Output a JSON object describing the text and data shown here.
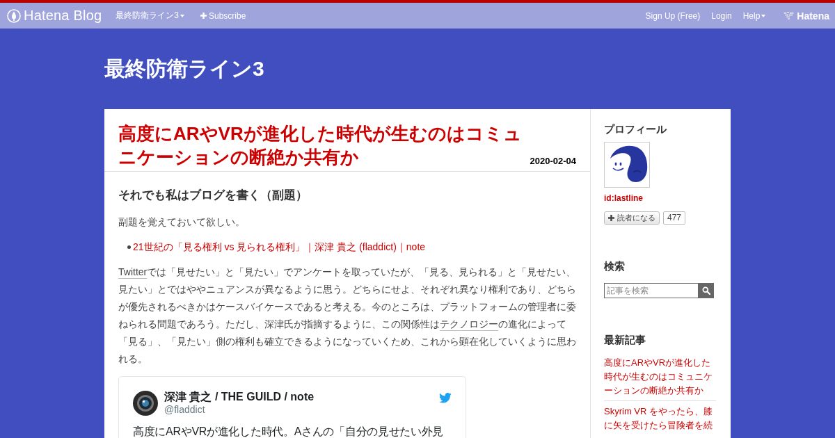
{
  "top_bar": {
    "logo_text": "Hatena Blog",
    "left_links": [
      {
        "label": "最終防衛ライン3",
        "kind": "dropdown"
      },
      {
        "label": "Subscribe",
        "kind": "plus"
      }
    ],
    "right_links": [
      {
        "label": "Sign Up (Free)",
        "kind": "plain"
      },
      {
        "label": "Login",
        "kind": "plain"
      },
      {
        "label": "Help",
        "kind": "dropdown"
      }
    ],
    "brand_text": "Hatena"
  },
  "blog_title": "最終防衛ライン3",
  "article": {
    "title": "高度にARやVRが進化した時代が生むのはコミュニケーションの断絶か共有か",
    "date": "2020-02-04",
    "subtitle": "それでも私はブログを書く（副題）",
    "intro": "副題を覚えておいて欲しい。",
    "links": [
      "21世紀の「見る権利 vs 見られる権利」｜深津 貴之 (fladdict)｜note"
    ],
    "paragraph": [
      {
        "kind": "keyword",
        "text": "Twitter"
      },
      {
        "kind": "text",
        "text": "では「見せたい」と「見たい」でアンケートを取っていたが、「見る、見られる」と「見せたい、見たい」とではややニュアンスが異なるように思う。どちらにせよ、それぞれ異なり権利であり、どちらが優先されるべきかはケースバイケースであると考える。今のところは、プラットフォームの管理者に委ねられる問題であろう。ただし、深津氏が指摘するように、この関係性は"
      },
      {
        "kind": "keyword",
        "text": "テクノロジー"
      },
      {
        "kind": "text",
        "text": "の進化によって「見る」、「見たい」側の権利も確立できるようになっていくため、これから顕在化していくように思われる。"
      }
    ],
    "tweet": {
      "name": "深津 貴之 / THE GUILD / note",
      "handle": "@fladdict",
      "text": "高度にARやVRが進化した時代。Aさんの「自分の見せたい外見"
    }
  },
  "sidebar": {
    "sections": [
      {
        "kind": "profile",
        "heading": "プロフィール",
        "user_id": "id:lastline",
        "subscribe_label": "読者になる",
        "subscriber_count": "477"
      },
      {
        "kind": "search",
        "heading": "検索",
        "placeholder": "記事を検索"
      },
      {
        "kind": "recent",
        "heading": "最新記事",
        "entries": [
          "高度にARやVRが進化した時代が生むのはコミュニケーションの断絶か共有か",
          "Skyrim VR をやったら、膝に矢を受けたら冒険者を続"
        ]
      }
    ]
  }
}
